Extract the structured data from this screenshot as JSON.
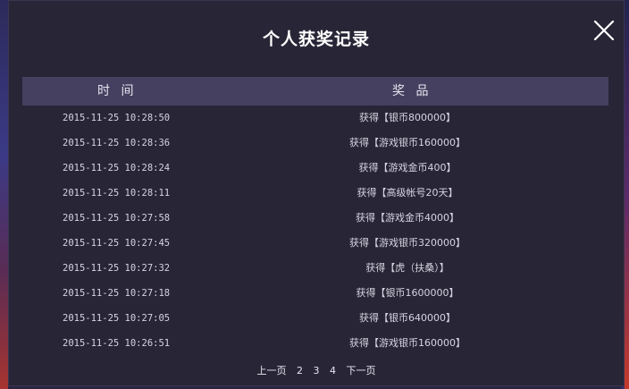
{
  "dialog": {
    "title": "个人获奖记录",
    "close_icon": "close-icon"
  },
  "table": {
    "headers": {
      "time": "时 间",
      "prize": "奖 品"
    },
    "rows": [
      {
        "time": "2015-11-25 10:28:50",
        "prize": "获得【银币800000】"
      },
      {
        "time": "2015-11-25 10:28:36",
        "prize": "获得【游戏银币160000】"
      },
      {
        "time": "2015-11-25 10:28:24",
        "prize": "获得【游戏金币400】"
      },
      {
        "time": "2015-11-25 10:28:11",
        "prize": "获得【高级帐号20天】"
      },
      {
        "time": "2015-11-25 10:27:58",
        "prize": "获得【游戏金币4000】"
      },
      {
        "time": "2015-11-25 10:27:45",
        "prize": "获得【游戏银币320000】"
      },
      {
        "time": "2015-11-25 10:27:32",
        "prize": "获得【虎（扶桑）】"
      },
      {
        "time": "2015-11-25 10:27:18",
        "prize": "获得【银币1600000】"
      },
      {
        "time": "2015-11-25 10:27:05",
        "prize": "获得【银币640000】"
      },
      {
        "time": "2015-11-25 10:26:51",
        "prize": "获得【游戏银币160000】"
      }
    ]
  },
  "pager": {
    "prev": "上一页",
    "pages": [
      "2",
      "3",
      "4"
    ],
    "next": "下一页"
  },
  "colors": {
    "background": "#282536",
    "header_bar": "#45405f",
    "text": "#d6d4e2",
    "title": "#ffffff"
  }
}
